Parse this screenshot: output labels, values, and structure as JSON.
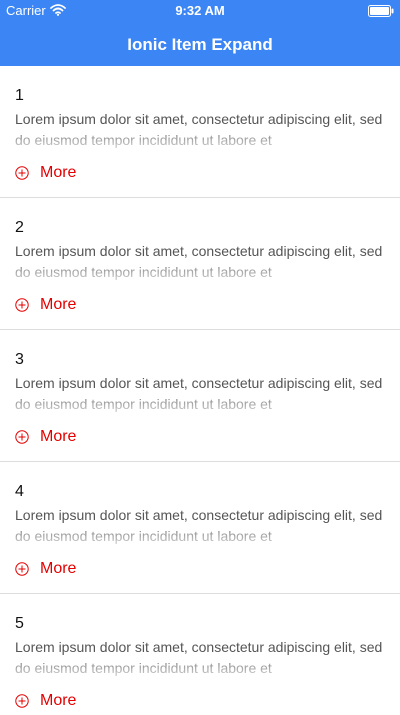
{
  "status_bar": {
    "carrier": "Carrier",
    "time": "9:32 AM"
  },
  "header": {
    "title": "Ionic Item Expand"
  },
  "list": {
    "items": [
      {
        "number": "1",
        "text": "Lorem ipsum dolor sit amet, consectetur adipiscing elit, sed do eiusmod tempor incididunt ut labore et",
        "more_label": "More"
      },
      {
        "number": "2",
        "text": "Lorem ipsum dolor sit amet, consectetur adipiscing elit, sed do eiusmod tempor incididunt ut labore et",
        "more_label": "More"
      },
      {
        "number": "3",
        "text": "Lorem ipsum dolor sit amet, consectetur adipiscing elit, sed do eiusmod tempor incididunt ut labore et",
        "more_label": "More"
      },
      {
        "number": "4",
        "text": "Lorem ipsum dolor sit amet, consectetur adipiscing elit, sed do eiusmod tempor incididunt ut labore et",
        "more_label": "More"
      },
      {
        "number": "5",
        "text": "Lorem ipsum dolor sit amet, consectetur adipiscing elit, sed do eiusmod tempor incididunt ut labore et",
        "more_label": "More"
      }
    ]
  },
  "icons": {
    "wifi": "wifi-icon",
    "battery": "battery-icon",
    "more": "plus-circle-icon"
  },
  "colors": {
    "header_background": "#3b86f4",
    "more_text": "#e40000",
    "divider": "#dddddd"
  }
}
